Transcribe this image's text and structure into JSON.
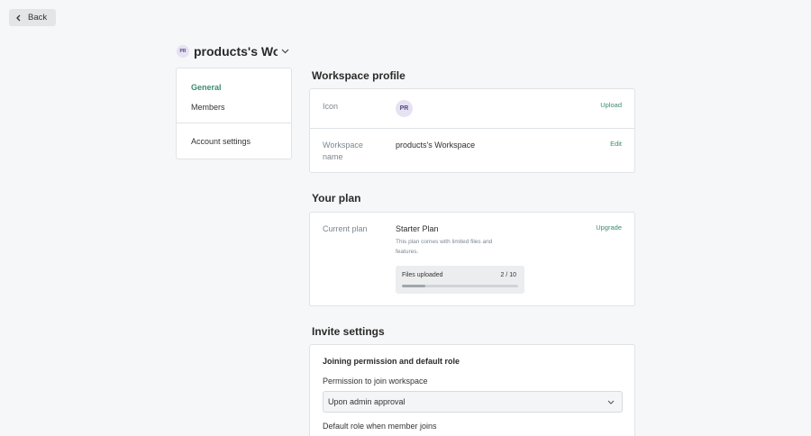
{
  "back": {
    "label": "Back"
  },
  "workspace": {
    "initials": "PR",
    "title": "products's Workspace"
  },
  "nav": {
    "items": [
      {
        "label": "General",
        "active": true
      },
      {
        "label": "Members",
        "active": false
      },
      {
        "label": "Account settings",
        "active": false
      }
    ]
  },
  "profile": {
    "heading": "Workspace profile",
    "icon_label": "Icon",
    "icon_initials": "PR",
    "upload_label": "Upload",
    "name_label_line1": "Workspace",
    "name_label_line2": "name",
    "name_value": "products's Workspace",
    "edit_label": "Edit"
  },
  "plan": {
    "heading": "Your plan",
    "current_label": "Current plan",
    "name": "Starter Plan",
    "description": "This plan comes with limited files and features.",
    "upgrade_label": "Upgrade",
    "files_label": "Files uploaded",
    "files_count": "2 / 10",
    "files_used": 2,
    "files_limit": 10
  },
  "invite": {
    "heading": "Invite settings",
    "subheading": "Joining permission and default role",
    "permission_label": "Permission to join workspace",
    "permission_value": "Upon admin approval",
    "default_role_label": "Default role when member joins"
  },
  "colors": {
    "accent": "#3d8b71",
    "avatar_bg": "#e6e2f2",
    "avatar_text": "#544a84"
  }
}
